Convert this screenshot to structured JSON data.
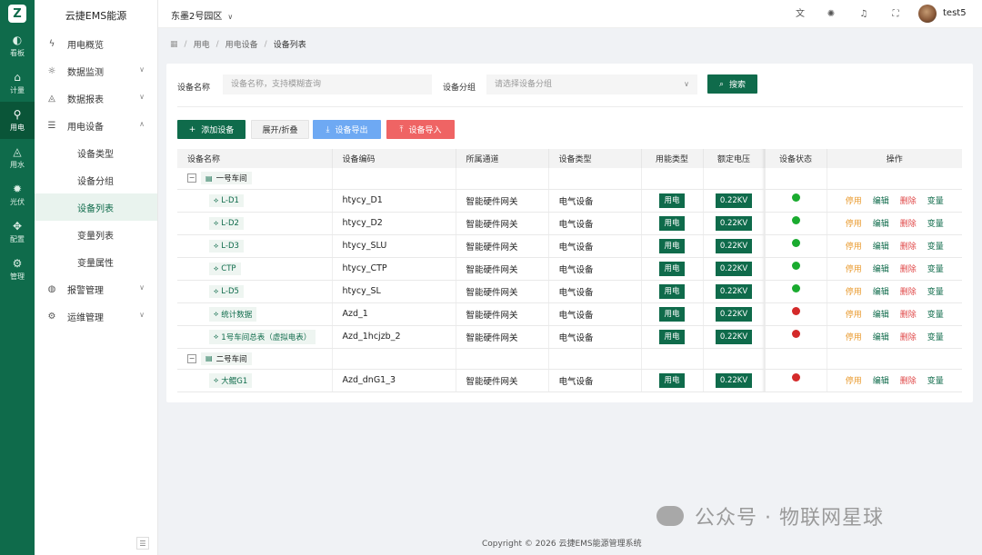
{
  "brand": {
    "logo": "Z",
    "app_name": "云捷EMS能源"
  },
  "rail": [
    {
      "icon": "dashboard-icon",
      "glyph": "◐",
      "label": "看板"
    },
    {
      "icon": "meter-icon",
      "glyph": "⌂",
      "label": "计量"
    },
    {
      "icon": "plug-icon",
      "glyph": "⚲",
      "label": "用电",
      "active": true
    },
    {
      "icon": "water-icon",
      "glyph": "◬",
      "label": "用水"
    },
    {
      "icon": "solar-icon",
      "glyph": "✹",
      "label": "光伏"
    },
    {
      "icon": "config-icon",
      "glyph": "✥",
      "label": "配置"
    },
    {
      "icon": "gear-icon",
      "glyph": "⚙",
      "label": "管理"
    }
  ],
  "menu": {
    "overview": "用电概览",
    "monitor": "数据监测",
    "report": "数据报表",
    "devices": "用电设备",
    "sub": [
      "设备类型",
      "设备分组",
      "设备列表",
      "变量列表",
      "变量属性"
    ],
    "alarm": "报警管理",
    "ops": "运维管理"
  },
  "header": {
    "park": "东墨2号园区",
    "username": "test5"
  },
  "breadcrumb": [
    "用电",
    "用电设备",
    "设备列表"
  ],
  "filter": {
    "name_label": "设备名称",
    "name_placeholder": "设备名称，支持模糊查询",
    "group_label": "设备分组",
    "group_placeholder": "请选择设备分组",
    "search_label": "搜索"
  },
  "toolbar": {
    "add": "添加设备",
    "fold": "展开/折叠",
    "export": "设备导出",
    "import": "设备导入"
  },
  "table": {
    "headers": [
      "设备名称",
      "设备编码",
      "所属通道",
      "设备类型",
      "用能类型",
      "额定电压",
      "设备状态",
      "操作"
    ],
    "actions": {
      "disable": "停用",
      "edit": "编辑",
      "delete": "删除",
      "variable": "变量"
    },
    "status_colors": {
      "on": "#1aab2f",
      "off": "#d42a2a"
    },
    "groups": [
      {
        "name": "一号车间",
        "devices": [
          {
            "name": "L-D1",
            "code": "htycy_D1",
            "channel": "智能硬件网关",
            "type": "电气设备",
            "energy": "用电",
            "voltage": "0.22KV",
            "status": "on"
          },
          {
            "name": "L-D2",
            "code": "htycy_D2",
            "channel": "智能硬件网关",
            "type": "电气设备",
            "energy": "用电",
            "voltage": "0.22KV",
            "status": "on"
          },
          {
            "name": "L-D3",
            "code": "htycy_SLU",
            "channel": "智能硬件网关",
            "type": "电气设备",
            "energy": "用电",
            "voltage": "0.22KV",
            "status": "on"
          },
          {
            "name": "CTP",
            "code": "htycy_CTP",
            "channel": "智能硬件网关",
            "type": "电气设备",
            "energy": "用电",
            "voltage": "0.22KV",
            "status": "on"
          },
          {
            "name": "L-D5",
            "code": "htycy_SL",
            "channel": "智能硬件网关",
            "type": "电气设备",
            "energy": "用电",
            "voltage": "0.22KV",
            "status": "on"
          },
          {
            "name": "统计数据",
            "code": "Azd_1",
            "channel": "智能硬件网关",
            "type": "电气设备",
            "energy": "用电",
            "voltage": "0.22KV",
            "status": "off"
          },
          {
            "name": "1号车间总表（虚拟电表）",
            "code": "Azd_1hcjzb_2",
            "channel": "智能硬件网关",
            "type": "电气设备",
            "energy": "用电",
            "voltage": "0.22KV",
            "status": "off"
          }
        ]
      },
      {
        "name": "二号车间",
        "devices": [
          {
            "name": "大鲲G1",
            "code": "Azd_dnG1_3",
            "channel": "智能硬件网关",
            "type": "电气设备",
            "energy": "用电",
            "voltage": "0.22KV",
            "status": "off"
          }
        ]
      }
    ]
  },
  "footer": "Copyright © 2026 云捷EMS能源管理系统",
  "watermark": "公众号 · 物联网星球"
}
